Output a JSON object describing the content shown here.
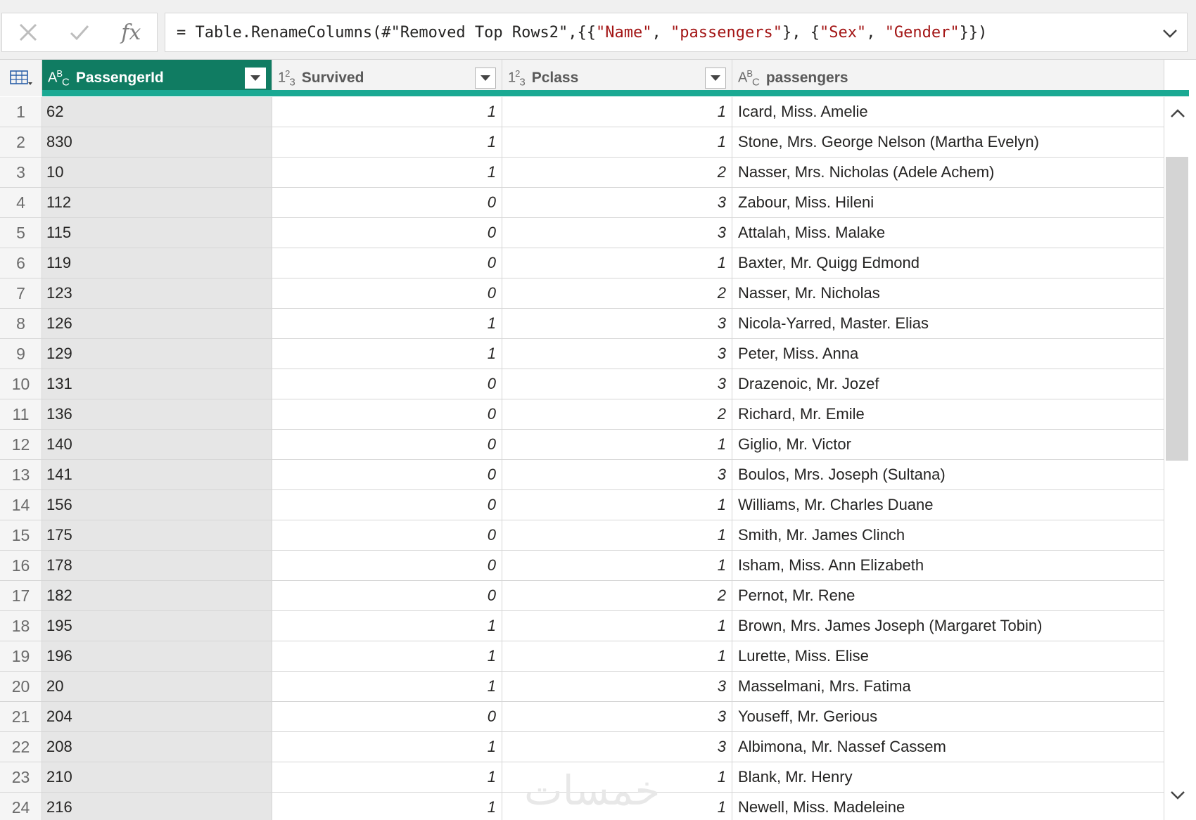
{
  "formula_bar": {
    "cancel_icon": "close-icon",
    "commit_icon": "check-icon",
    "fx_label": "fx",
    "parts": [
      {
        "t": "= Table.RenameColumns(#\"Removed Top Rows2\",{{",
        "s": false
      },
      {
        "t": "\"Name\"",
        "s": true
      },
      {
        "t": ", ",
        "s": false
      },
      {
        "t": "\"passengers\"",
        "s": true
      },
      {
        "t": "}, {",
        "s": false
      },
      {
        "t": "\"Sex\"",
        "s": true
      },
      {
        "t": ", ",
        "s": false
      },
      {
        "t": "\"Gender\"",
        "s": true
      },
      {
        "t": "}})",
        "s": false
      }
    ]
  },
  "columns": [
    {
      "type_icon": "ABC",
      "name": "PassengerId",
      "selected": true
    },
    {
      "type_icon": "123",
      "name": "Survived",
      "selected": false
    },
    {
      "type_icon": "123",
      "name": "Pclass",
      "selected": false
    },
    {
      "type_icon": "ABC",
      "name": "passengers",
      "selected": false
    }
  ],
  "rows": [
    [
      "1",
      "62",
      "1",
      "1",
      "Icard, Miss. Amelie"
    ],
    [
      "2",
      "830",
      "1",
      "1",
      "Stone, Mrs. George Nelson (Martha Evelyn)"
    ],
    [
      "3",
      "10",
      "1",
      "2",
      "Nasser, Mrs. Nicholas (Adele Achem)"
    ],
    [
      "4",
      "112",
      "0",
      "3",
      "Zabour, Miss. Hileni"
    ],
    [
      "5",
      "115",
      "0",
      "3",
      "Attalah, Miss. Malake"
    ],
    [
      "6",
      "119",
      "0",
      "1",
      "Baxter, Mr. Quigg Edmond"
    ],
    [
      "7",
      "123",
      "0",
      "2",
      "Nasser, Mr. Nicholas"
    ],
    [
      "8",
      "126",
      "1",
      "3",
      "Nicola-Yarred, Master. Elias"
    ],
    [
      "9",
      "129",
      "1",
      "3",
      "Peter, Miss. Anna"
    ],
    [
      "10",
      "131",
      "0",
      "3",
      "Drazenoic, Mr. Jozef"
    ],
    [
      "11",
      "136",
      "0",
      "2",
      "Richard, Mr. Emile"
    ],
    [
      "12",
      "140",
      "0",
      "1",
      "Giglio, Mr. Victor"
    ],
    [
      "13",
      "141",
      "0",
      "3",
      "Boulos, Mrs. Joseph (Sultana)"
    ],
    [
      "14",
      "156",
      "0",
      "1",
      "Williams, Mr. Charles Duane"
    ],
    [
      "15",
      "175",
      "0",
      "1",
      "Smith, Mr. James Clinch"
    ],
    [
      "16",
      "178",
      "0",
      "1",
      "Isham, Miss. Ann Elizabeth"
    ],
    [
      "17",
      "182",
      "0",
      "2",
      "Pernot, Mr. Rene"
    ],
    [
      "18",
      "195",
      "1",
      "1",
      "Brown, Mrs. James Joseph (Margaret Tobin)"
    ],
    [
      "19",
      "196",
      "1",
      "1",
      "Lurette, Miss. Elise"
    ],
    [
      "20",
      "20",
      "1",
      "3",
      "Masselmani, Mrs. Fatima"
    ],
    [
      "21",
      "204",
      "0",
      "3",
      "Youseff, Mr. Gerious"
    ],
    [
      "22",
      "208",
      "1",
      "3",
      "Albimona, Mr. Nassef Cassem"
    ],
    [
      "23",
      "210",
      "1",
      "1",
      "Blank, Mr. Henry"
    ],
    [
      "24",
      "216",
      "1",
      "1",
      "Newell, Miss. Madeleine"
    ]
  ],
  "watermark": "خمسات",
  "colors": {
    "selected_header": "#107c62",
    "quality_bar": "#1aa993"
  }
}
